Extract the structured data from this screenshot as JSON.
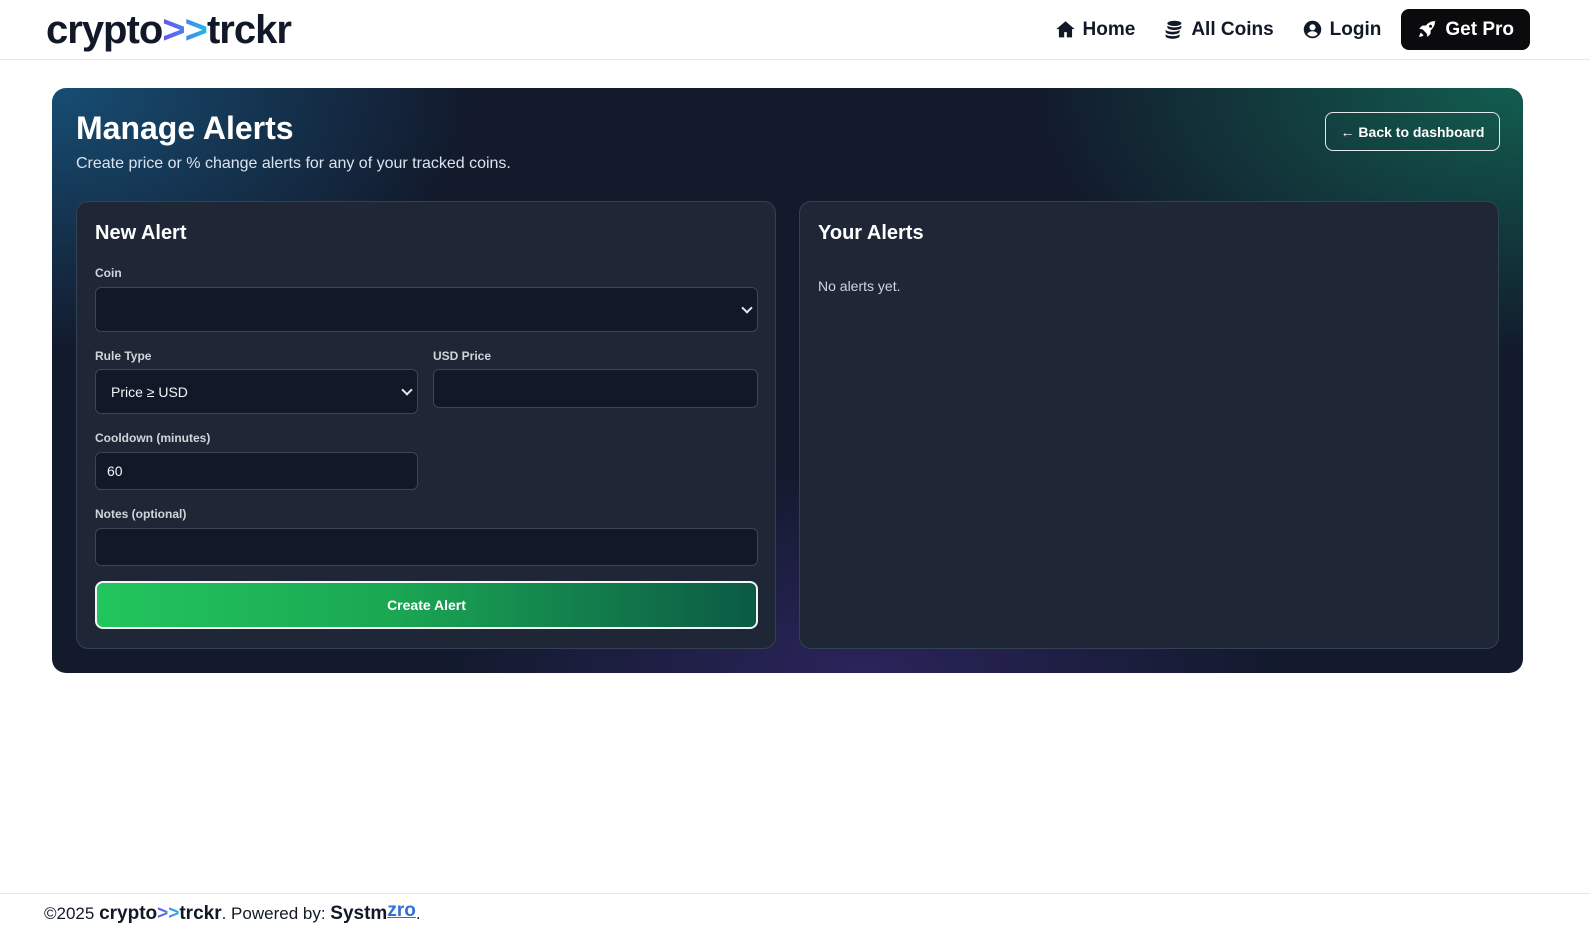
{
  "nav": {
    "logo_prefix": "crypto",
    "logo_arrows": ">>",
    "logo_suffix": "trckr",
    "links": [
      {
        "label": "Home",
        "icon": "home-icon"
      },
      {
        "label": "All Coins",
        "icon": "coins-icon"
      },
      {
        "label": "Login",
        "icon": "user-circle-icon"
      },
      {
        "label": "Get Pro",
        "icon": "rocket-icon"
      }
    ]
  },
  "page": {
    "title": "Manage Alerts",
    "subtitle": "Create price or % change alerts for any of your tracked coins.",
    "back_label": "← Back to dashboard"
  },
  "new_alert": {
    "title": "New Alert",
    "coin_label": "Coin",
    "coin_value": "",
    "rule_type_label": "Rule Type",
    "rule_type_value": "Price ≥ USD",
    "usd_price_label": "USD Price",
    "usd_price_value": "",
    "cooldown_label": "Cooldown (minutes)",
    "cooldown_value": "60",
    "notes_label": "Notes (optional)",
    "notes_value": "",
    "submit_label": "Create Alert"
  },
  "your_alerts": {
    "title": "Your Alerts",
    "empty_text": "No alerts yet."
  },
  "footer": {
    "copyright": "©2025 ",
    "brand_prefix": "crypto",
    "brand_arrows": ">>",
    "brand_suffix": "trckr",
    "powered_by": ". Powered by: ",
    "systm": "Systm",
    "zro": "zro",
    "end": "."
  },
  "colors": {
    "accent_green": "#22c55e",
    "link_blue": "#2f6fd6",
    "panel_bg": "#1f2737"
  }
}
